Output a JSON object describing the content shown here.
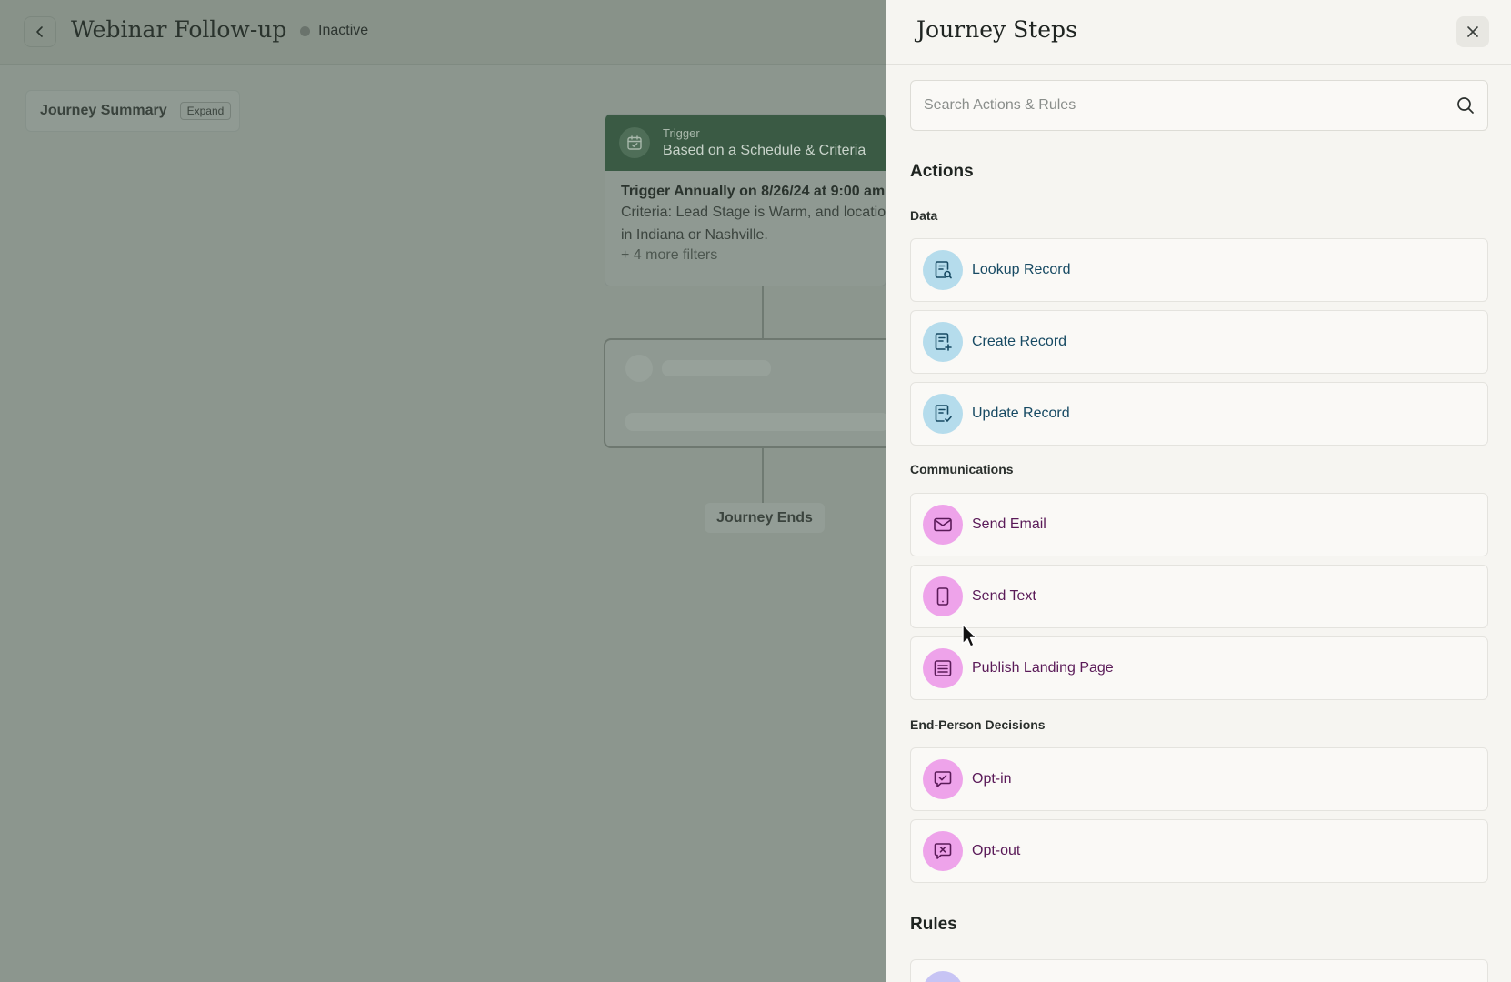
{
  "canvas": {
    "page_title": "Webinar Follow-up",
    "status_label": "Inactive",
    "summary": {
      "label": "Journey Summary",
      "expand_label": "Expand"
    },
    "trigger": {
      "kicker": "Trigger",
      "title": "Based on a Schedule & Criteria",
      "schedule": "Trigger Annually on 8/26/24 at 9:00 am",
      "criteria_line1": "Criteria: Lead Stage is Warm, and location",
      "criteria_line2": "in Indiana or Nashville.",
      "more_filters": "+ 4 more filters"
    },
    "journey_ends_label": "Journey Ends"
  },
  "panel": {
    "title": "Journey Steps",
    "search": {
      "placeholder": "Search Actions & Rules",
      "value": ""
    },
    "actions_heading": "Actions",
    "groups": [
      {
        "label": "Data",
        "items": [
          {
            "label": "Lookup Record",
            "icon": "document-search-icon"
          },
          {
            "label": "Create Record",
            "icon": "document-plus-icon"
          },
          {
            "label": "Update Record",
            "icon": "document-check-icon"
          }
        ]
      },
      {
        "label": "Communications",
        "items": [
          {
            "label": "Send Email",
            "icon": "mail-icon"
          },
          {
            "label": "Send Text",
            "icon": "phone-icon"
          },
          {
            "label": "Publish Landing Page",
            "icon": "page-lines-icon"
          }
        ]
      },
      {
        "label": "End-Person Decisions",
        "items": [
          {
            "label": "Opt-in",
            "icon": "chat-check-icon"
          },
          {
            "label": "Opt-out",
            "icon": "chat-x-icon"
          }
        ]
      }
    ],
    "rules_heading": "Rules"
  },
  "colors": {
    "data_icon_bg": "#b5dcec",
    "comm_icon_bg": "#eea3ea",
    "trigger_header": "#3a5a44",
    "overlay": "#8c968e"
  }
}
